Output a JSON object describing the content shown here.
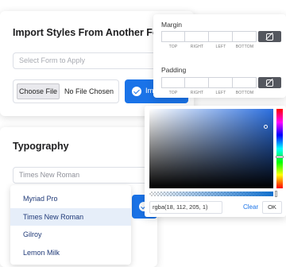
{
  "import_card": {
    "title": "Import Styles From Another Form",
    "select_placeholder": "Select Form to Apply",
    "choose_file_label": "Choose File",
    "file_status": "No File Chosen",
    "import_button_label": "Import"
  },
  "typography_card": {
    "title": "Typography",
    "font_select_value": "Times New Roman",
    "dropdown_options": [
      {
        "label": "Myriad Pro",
        "selected": false
      },
      {
        "label": "Times New Roman",
        "selected": true
      },
      {
        "label": "Gilroy",
        "selected": false
      },
      {
        "label": "Lemon Milk",
        "selected": false
      }
    ]
  },
  "spacing_panel": {
    "margin_label": "Margin",
    "padding_label": "Padding",
    "sides": [
      "TOP",
      "RIGHT",
      "LEFT",
      "BOTTOM"
    ],
    "link_icon": "link-off-icon"
  },
  "color_picker": {
    "value": "rgba(18, 112, 205, 1)",
    "clear_label": "Clear",
    "ok_label": "OK",
    "accent_color": "#1270cd"
  },
  "colors": {
    "primary": "#1a73e8",
    "dropdown_text": "#203a78",
    "selected_option_bg": "#e6eef9"
  }
}
